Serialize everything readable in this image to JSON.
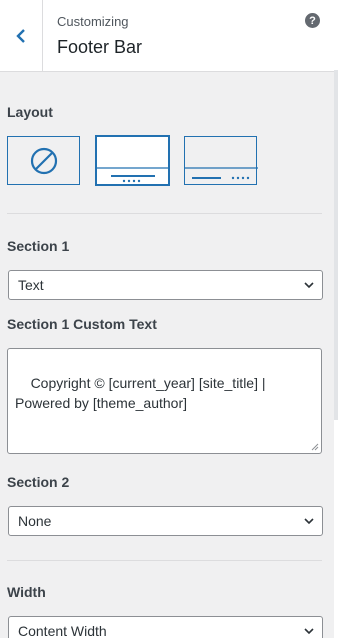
{
  "header": {
    "subtitle": "Customizing",
    "title": "Footer Bar",
    "help_symbol": "?"
  },
  "layout": {
    "label": "Layout",
    "options": [
      "none",
      "centered",
      "split"
    ],
    "selected": "centered"
  },
  "section1": {
    "label": "Section 1",
    "value": "Text",
    "custom_text_label": "Section 1 Custom Text",
    "custom_text_value": "Copyright © [current_year] [site_title] |\nPowered by [theme_author]"
  },
  "section2": {
    "label": "Section 2",
    "value": "None"
  },
  "width": {
    "label": "Width",
    "value": "Content Width"
  },
  "colors": {
    "accent": "#2271b1",
    "panel_bg": "#f0f0f1",
    "border": "#8c8f94"
  }
}
